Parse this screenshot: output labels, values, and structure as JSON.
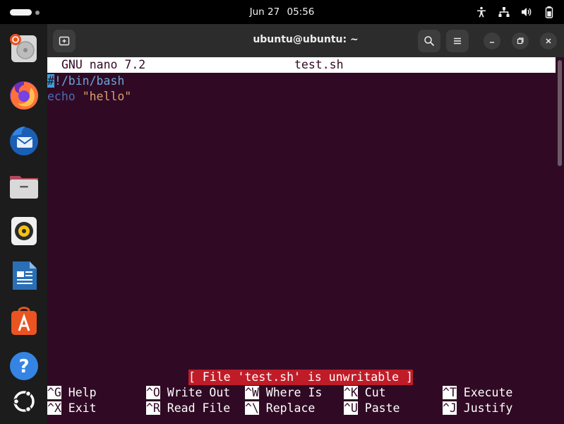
{
  "topbar": {
    "date": "Jun 27",
    "time": "05:56",
    "tray_icons": [
      "accessibility-icon",
      "network-icon",
      "volume-icon",
      "battery-icon"
    ]
  },
  "dock": {
    "apps": [
      "disk-usage-icon",
      "firefox-icon",
      "thunderbird-icon",
      "files-icon",
      "rhythmbox-icon",
      "libreoffice-writer-icon",
      "app-center-icon",
      "help-icon",
      "show-apps-icon"
    ]
  },
  "window": {
    "title": "ubuntu@ubuntu: ~"
  },
  "nano": {
    "version": "GNU nano 7.2",
    "filename": "test.sh",
    "lines": {
      "shebang_cursor": "#",
      "shebang_rest": "!/bin/bash",
      "echo_keyword": "echo",
      "echo_space": " ",
      "echo_string": "\"hello\""
    },
    "status": "[ File 'test.sh' is unwritable ]",
    "shortcuts": [
      {
        "key": "^G",
        "label": " Help"
      },
      {
        "key": "^O",
        "label": " Write Out"
      },
      {
        "key": "^W",
        "label": " Where Is"
      },
      {
        "key": "^K",
        "label": " Cut"
      },
      {
        "key": "^T",
        "label": " Execute"
      },
      {
        "key": "^X",
        "label": " Exit"
      },
      {
        "key": "^R",
        "label": " Read File"
      },
      {
        "key": "^\\",
        "label": " Replace"
      },
      {
        "key": "^U",
        "label": " Paste"
      },
      {
        "key": "^J",
        "label": " Justify"
      }
    ]
  },
  "colors": {
    "terminal_bg": "#300a24",
    "status_bg": "#c01c28",
    "header_bg": "#ffffff"
  }
}
